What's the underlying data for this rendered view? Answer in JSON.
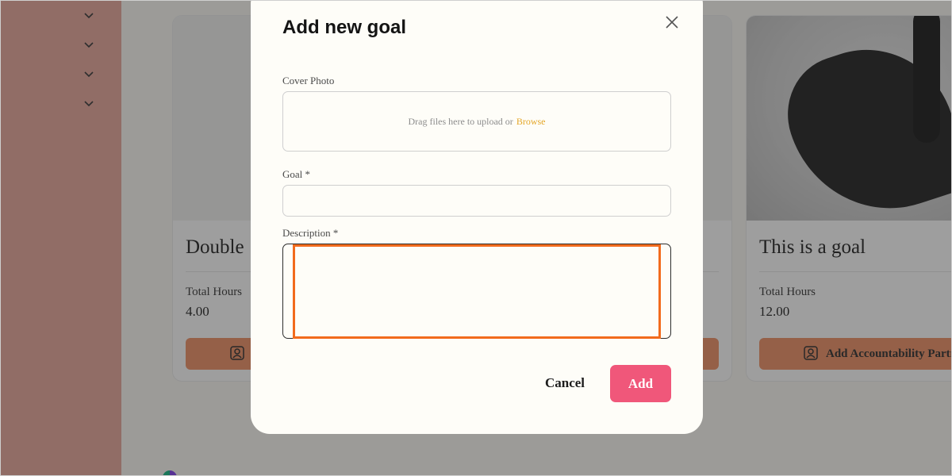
{
  "sidebar": {
    "icons": [
      "chevron-down-icon",
      "chevron-down-icon",
      "chevron-down-icon",
      "chevron-down-icon"
    ]
  },
  "cards": [
    {
      "title": "Double",
      "hours_label": "Total Hours",
      "hours_value": "4.00",
      "partner_button_label": "",
      "partner_icon": "user-portrait-icon"
    },
    {
      "title": "This is a goal",
      "hours_label": "Total Hours",
      "hours_value": "12.00",
      "partner_button_label": "Add Accountability Partn",
      "partner_icon": "user-portrait-icon"
    }
  ],
  "modal": {
    "title": "Add new goal",
    "close_icon": "close-icon",
    "cover_photo": {
      "label": "Cover Photo",
      "dropzone_text": "Drag files here to upload or",
      "browse_link": "Browse"
    },
    "goal": {
      "label": "Goal *",
      "value": ""
    },
    "description": {
      "label": "Description *",
      "value": ""
    },
    "cancel_label": "Cancel",
    "add_label": "Add"
  },
  "colors": {
    "sidebar": "#e8a79a",
    "accent_add": "#f0577a",
    "partner_button": "#ef8e63",
    "browse_link": "#e4a72a",
    "focus_highlight": "#f26b1d"
  }
}
